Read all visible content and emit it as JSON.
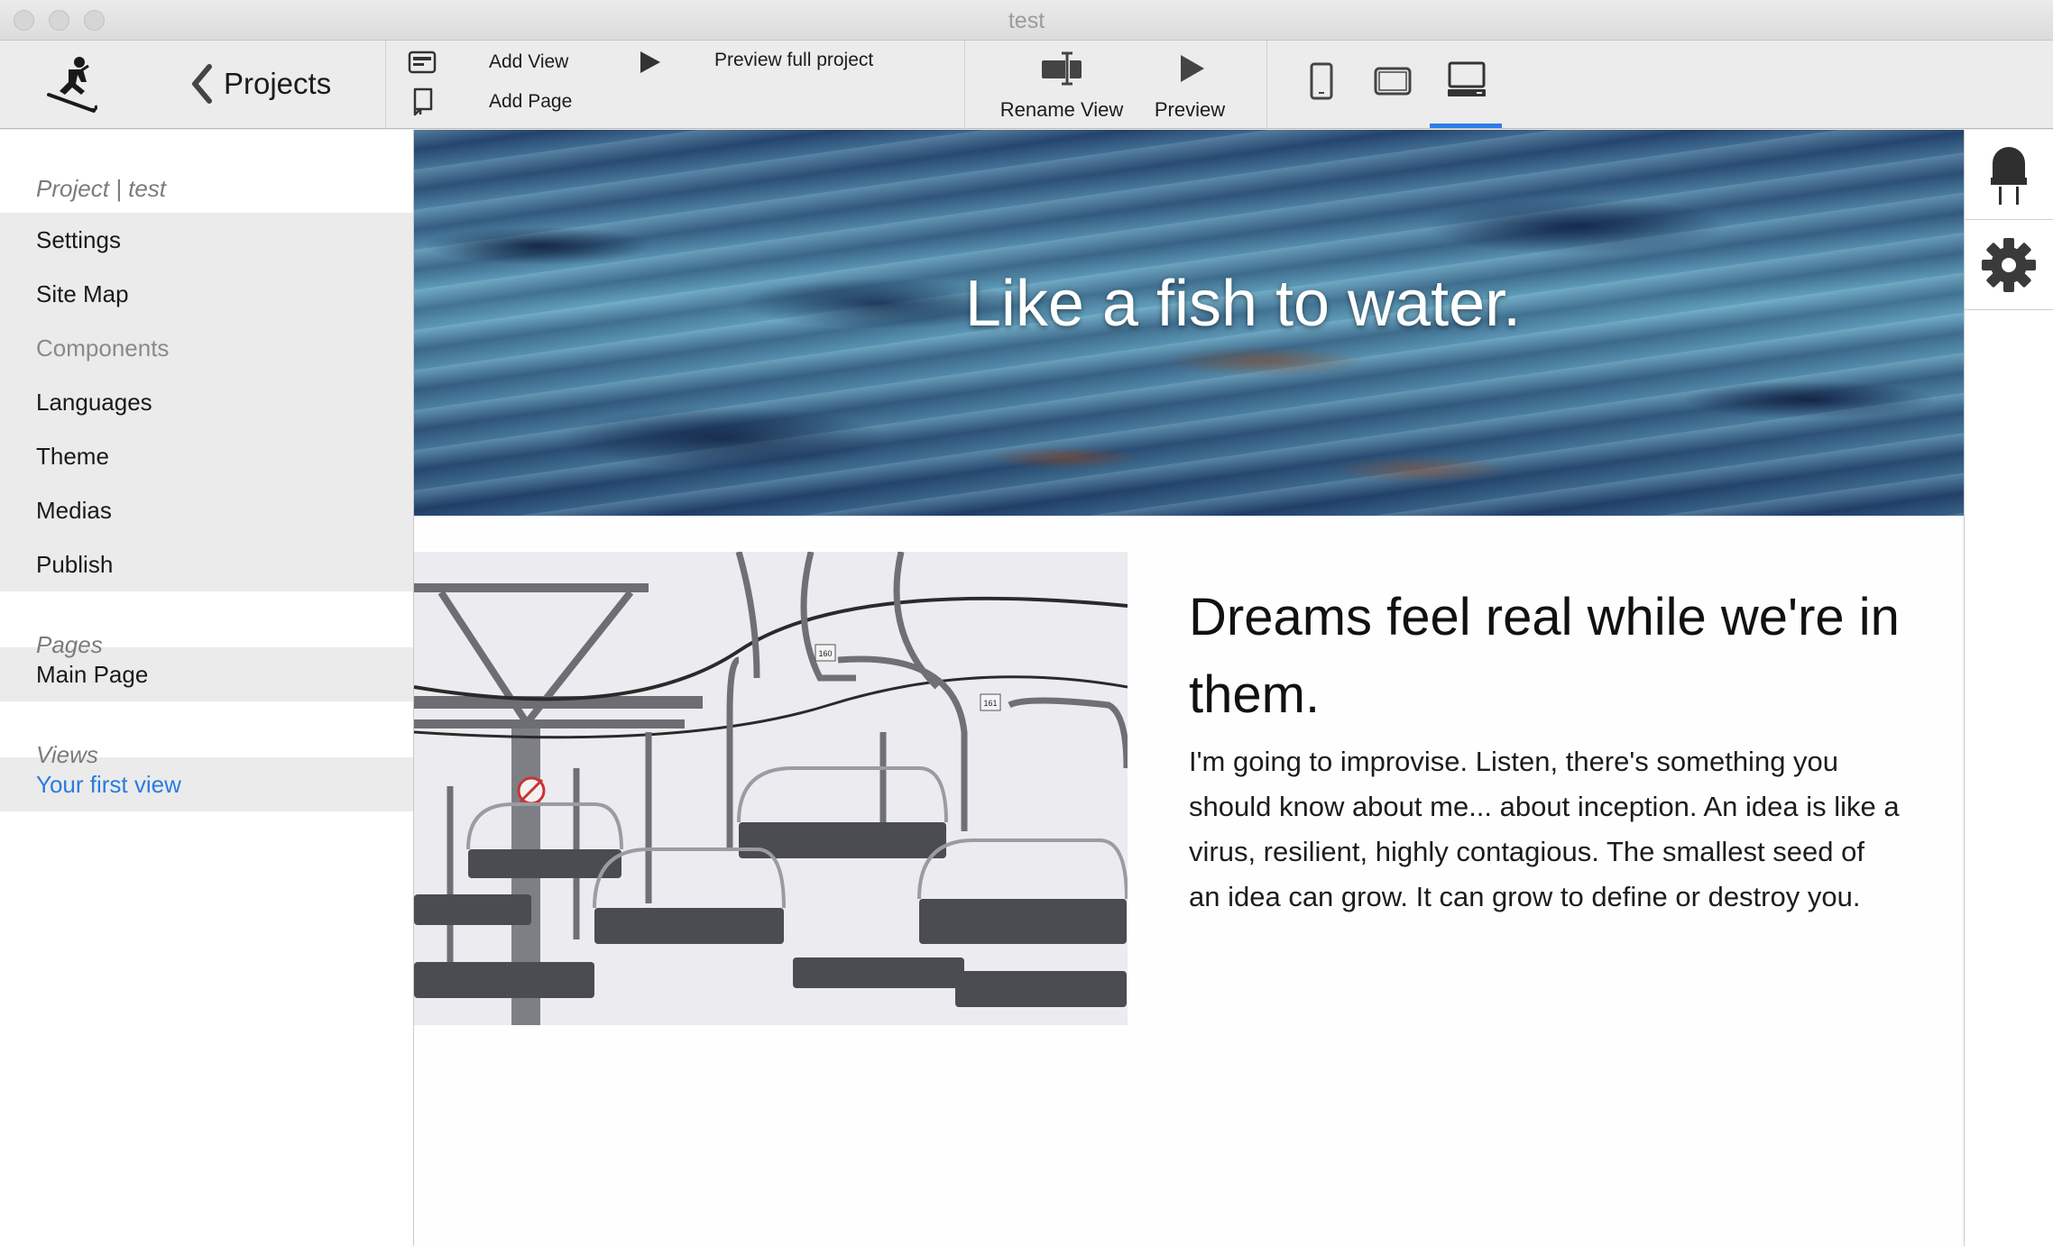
{
  "window": {
    "title": "test"
  },
  "toolbar": {
    "back_label": "Projects",
    "add_view": "Add View",
    "add_page": "Add Page",
    "preview_full": "Preview full project",
    "rename_view": "Rename View",
    "preview": "Preview",
    "devices": [
      "phone-icon",
      "tablet-icon",
      "desktop-icon"
    ],
    "selected_device": "desktop",
    "accent_color": "#2b7de9"
  },
  "sidebar": {
    "project_header": "Project | test",
    "project_items": [
      {
        "label": "Settings"
      },
      {
        "label": "Site Map"
      },
      {
        "label": "Components"
      },
      {
        "label": "Languages"
      },
      {
        "label": "Theme"
      },
      {
        "label": "Medias"
      },
      {
        "label": "Publish"
      }
    ],
    "pages_header": "Pages",
    "pages": [
      {
        "label": "Main Page"
      }
    ],
    "views_header": "Views",
    "views": [
      {
        "label": "Your first view"
      }
    ]
  },
  "canvas": {
    "hero_title": "Like a fish to water.",
    "heading": "Dreams feel real while we're in them.",
    "body": "I'm going to improvise. Listen, there's something you should know about me... about inception. An idea is like a virus, resilient, highly contagious. The smallest seed of an idea can grow. It can grow to define or destroy you.",
    "chair_numbers": [
      "160",
      "161"
    ]
  },
  "rightbar": {
    "icons": [
      "led-component-icon",
      "gear-icon"
    ]
  }
}
